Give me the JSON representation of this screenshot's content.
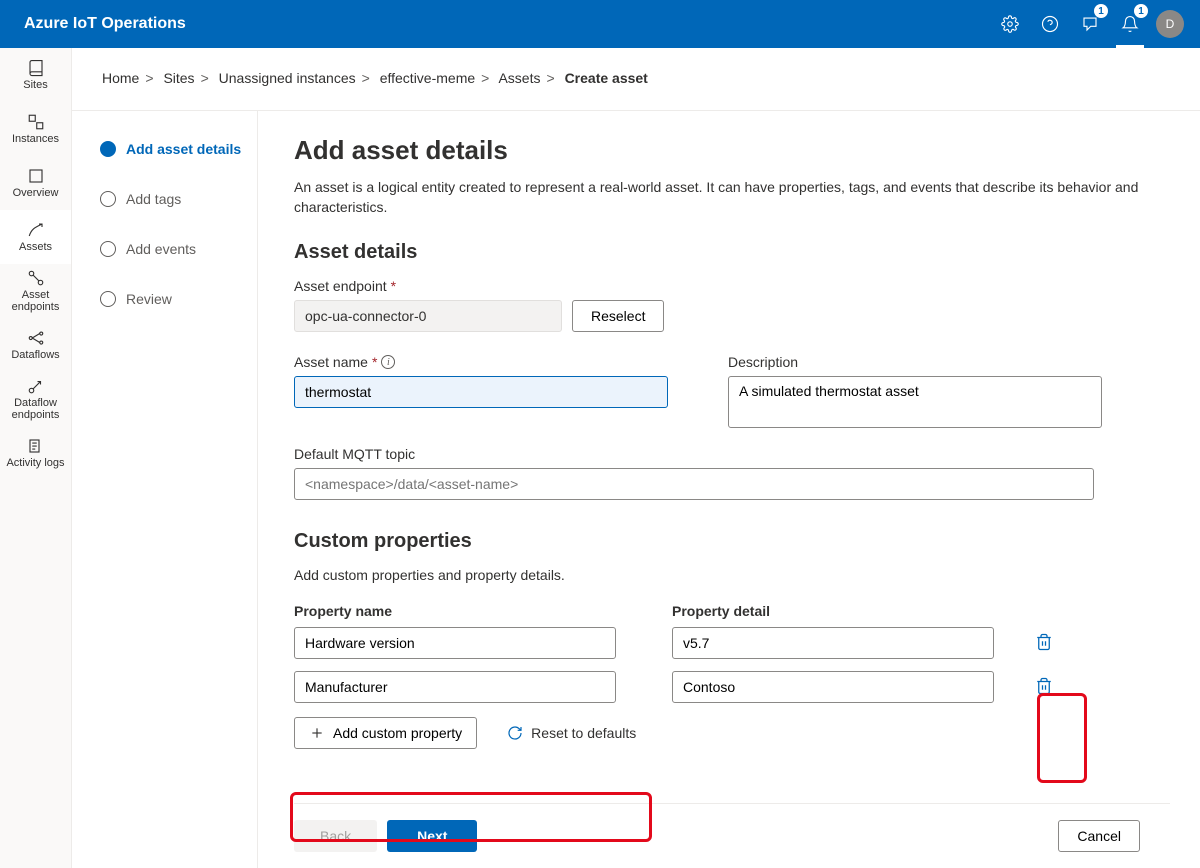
{
  "brand": "Azure IoT Operations",
  "badge1": "1",
  "badge2": "1",
  "avatar": "D",
  "sidebar": {
    "items": [
      {
        "label": "Sites"
      },
      {
        "label": "Instances"
      },
      {
        "label": "Overview"
      },
      {
        "label": "Assets"
      },
      {
        "label": "Asset endpoints"
      },
      {
        "label": "Dataflows"
      },
      {
        "label": "Dataflow endpoints"
      },
      {
        "label": "Activity logs"
      }
    ]
  },
  "breadcrumb": {
    "home": "Home",
    "sites": "Sites",
    "unassigned": "Unassigned instances",
    "instance": "effective-meme",
    "assets": "Assets",
    "current": "Create asset"
  },
  "steps": {
    "s1": "Add asset details",
    "s2": "Add tags",
    "s3": "Add events",
    "s4": "Review"
  },
  "page": {
    "title": "Add asset details",
    "intro": "An asset is a logical entity created to represent a real-world asset. It can have properties, tags, and events that describe its behavior and characteristics."
  },
  "details": {
    "heading": "Asset details",
    "endpoint_label": "Asset endpoint",
    "endpoint_value": "opc-ua-connector-0",
    "reselect": "Reselect",
    "name_label": "Asset name",
    "name_value": "thermostat",
    "desc_label": "Description",
    "desc_value": "A simulated thermostat asset",
    "mqtt_label": "Default MQTT topic",
    "mqtt_placeholder": "<namespace>/data/<asset-name>"
  },
  "custom": {
    "heading": "Custom properties",
    "sub": "Add custom properties and property details.",
    "name_header": "Property name",
    "detail_header": "Property detail",
    "rows": [
      {
        "name": "Hardware version",
        "detail": "v5.7"
      },
      {
        "name": "Manufacturer",
        "detail": "Contoso"
      }
    ],
    "add_btn": "Add custom property",
    "reset_btn": "Reset to defaults"
  },
  "footer": {
    "back": "Back",
    "next": "Next",
    "cancel": "Cancel"
  }
}
